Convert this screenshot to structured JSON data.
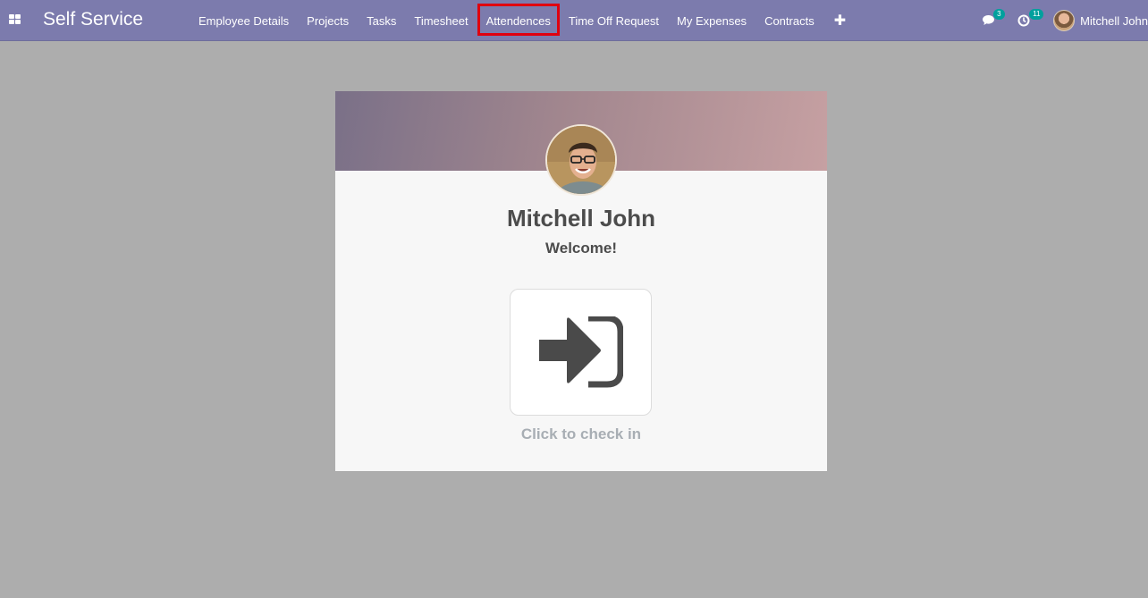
{
  "app": {
    "title": "Self Service"
  },
  "menu": {
    "items": [
      {
        "label": "Employee Details"
      },
      {
        "label": "Projects"
      },
      {
        "label": "Tasks"
      },
      {
        "label": "Timesheet"
      },
      {
        "label": "Attendences",
        "highlighted": true
      },
      {
        "label": "Time Off Request"
      },
      {
        "label": "My Expenses"
      },
      {
        "label": "Contracts"
      }
    ],
    "add_icon": "plus-icon"
  },
  "systray": {
    "messages_count": "3",
    "activities_count": "11",
    "user_name": "Mitchell John"
  },
  "attendance": {
    "employee_name": "Mitchell John",
    "greeting": "Welcome!",
    "checkin_label": "Click to check in",
    "checkin_icon": "sign-in-icon"
  },
  "colors": {
    "navbar": "#7c7bad",
    "highlight_border": "#e0000f",
    "badge": "#00a09d"
  }
}
